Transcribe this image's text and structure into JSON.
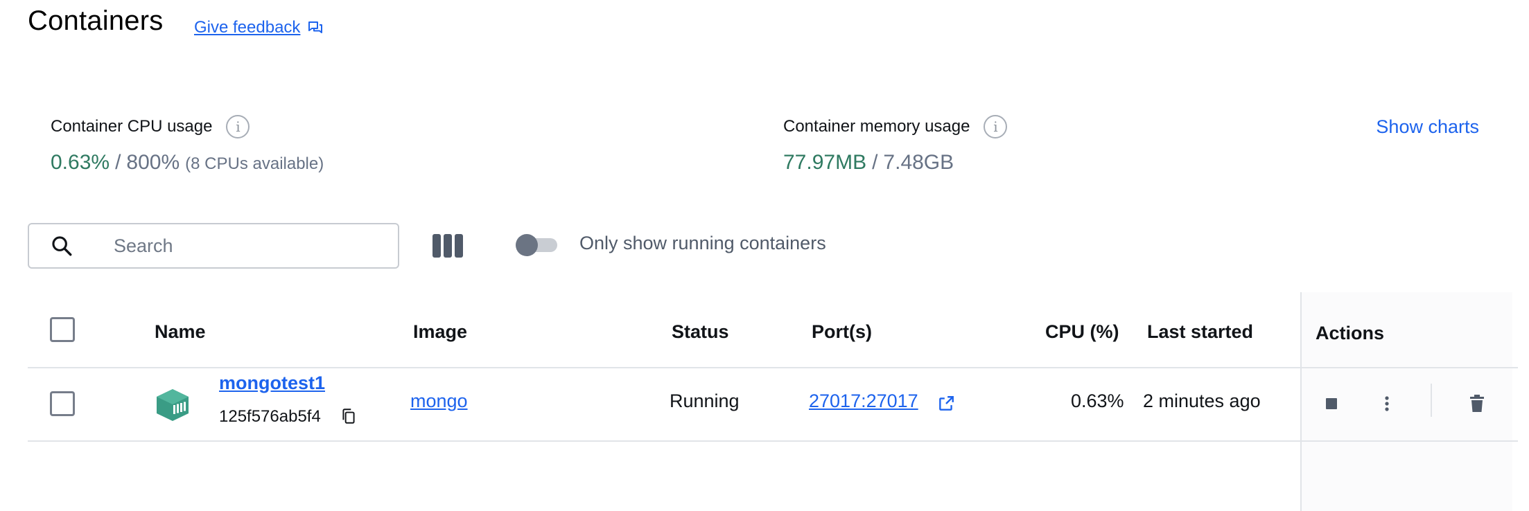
{
  "header": {
    "title": "Containers",
    "feedback_label": "Give feedback"
  },
  "stats": {
    "cpu": {
      "label": "Container CPU usage",
      "used": "0.63%",
      "separator": "/",
      "total": "800%",
      "extra": "(8 CPUs available)"
    },
    "memory": {
      "label": "Container memory usage",
      "used": "77.97MB",
      "separator": "/",
      "total": "7.48GB"
    },
    "show_charts_label": "Show charts"
  },
  "toolbar": {
    "search_placeholder": "Search",
    "running_toggle_label": "Only show running containers",
    "running_toggle_on": false
  },
  "table": {
    "columns": {
      "name": "Name",
      "image": "Image",
      "status": "Status",
      "ports": "Port(s)",
      "cpu": "CPU (%)",
      "last_started": "Last started",
      "actions": "Actions"
    },
    "rows": [
      {
        "name": "mongotest1",
        "id": "125f576ab5f4",
        "image": "mongo",
        "status": "Running",
        "ports": "27017:27017",
        "cpu": "0.63%",
        "last_started": "2 minutes ago"
      }
    ]
  },
  "icons": {
    "feedback": "chat-bubbles-icon",
    "info": "info-icon",
    "search": "search-icon",
    "columns": "columns-icon",
    "container": "container-icon",
    "copy": "copy-icon",
    "external_link": "external-link-icon",
    "stop": "stop-icon",
    "more": "more-vertical-icon",
    "delete": "trash-icon"
  },
  "colors": {
    "accent": "#1d63ed",
    "usage_green": "#2f7a61",
    "container_icon": "#3a9c85"
  }
}
